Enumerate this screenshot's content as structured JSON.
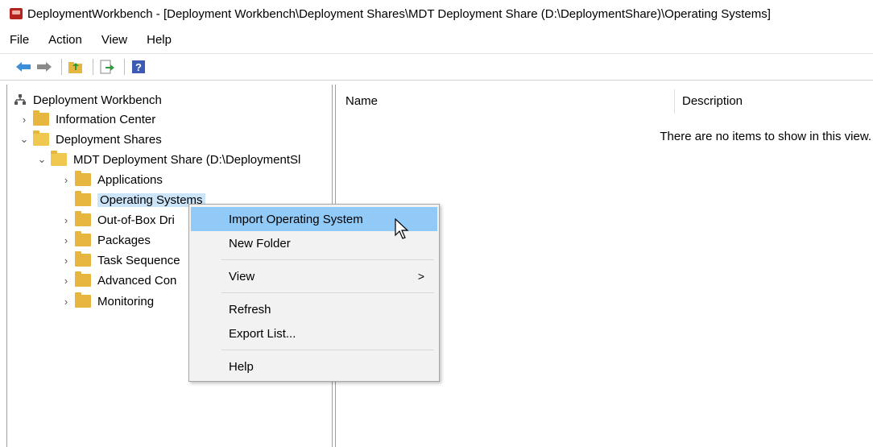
{
  "window": {
    "title": "DeploymentWorkbench - [Deployment Workbench\\Deployment Shares\\MDT Deployment Share (D:\\DeploymentShare)\\Operating Systems]"
  },
  "menubar": {
    "items": [
      "File",
      "Action",
      "View",
      "Help"
    ]
  },
  "toolbar": {
    "buttons": [
      "back-arrow-icon",
      "forward-arrow-icon",
      "up-folder-icon",
      "export-list-icon",
      "help-icon"
    ]
  },
  "tree": {
    "root": "Deployment Workbench",
    "information_center": "Information Center",
    "deployment_shares": "Deployment Shares",
    "mdt_share": "MDT Deployment Share (D:\\DeploymentSl",
    "applications": "Applications",
    "operating_systems": "Operating Systems",
    "out_of_box": "Out-of-Box Dri",
    "packages": "Packages",
    "task_sequences": "Task Sequence",
    "advanced_config": "Advanced Con",
    "monitoring": "Monitoring"
  },
  "list": {
    "columns": [
      "Name",
      "Description"
    ],
    "empty_message": "There are no items to show in this view."
  },
  "context_menu": {
    "import_os": "Import Operating System",
    "new_folder": "New Folder",
    "view": "View",
    "view_arrow": ">",
    "refresh": "Refresh",
    "export_list": "Export List...",
    "help": "Help"
  },
  "colors": {
    "menu_highlight": "#91c9f7",
    "selection": "#cce4f7",
    "folder": "#e6b63f"
  }
}
